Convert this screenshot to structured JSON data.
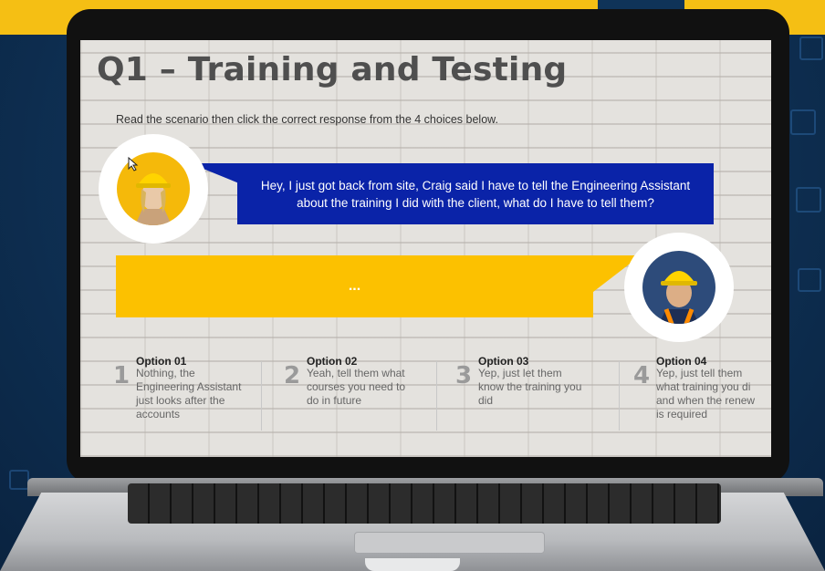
{
  "slide": {
    "title": "Q1 – Training and Testing",
    "instruction": "Read the scenario then click the correct response from the 4 choices below."
  },
  "scenario": {
    "speaker_message": "Hey, I just got back from site, Craig said I have to tell the Engineering Assistant about the training I did with the client, what do I have to tell them?",
    "response_placeholder": "..."
  },
  "options": [
    {
      "number": "1",
      "title": "Option 01",
      "text": "Nothing, the Engineering Assistant just looks after the accounts"
    },
    {
      "number": "2",
      "title": "Option 02",
      "text": "Yeah, tell them what courses you need to do in future"
    },
    {
      "number": "3",
      "title": "Option 03",
      "text": "Yep, just let them know the training you did"
    },
    {
      "number": "4",
      "title": "Option 04",
      "text": "Yep, just tell them what training you di and when the renew is required"
    }
  ],
  "colors": {
    "accent_yellow": "#fcc100",
    "speech_blue": "#0a23a8",
    "background_navy": "#0f3358"
  }
}
